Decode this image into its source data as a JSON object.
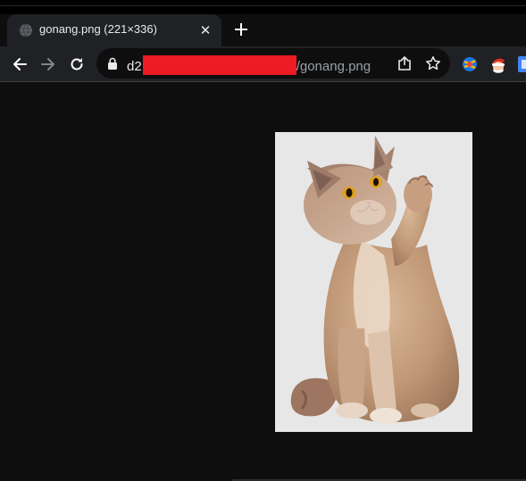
{
  "tab": {
    "title": "gonang.png (221×336)",
    "favicon": "globe-icon",
    "close": "✕"
  },
  "toolbar": {
    "back": "arrow-left-icon",
    "forward": "arrow-right-icon",
    "reload": "reload-icon"
  },
  "omnibox": {
    "host_prefix": "d2",
    "path": "/gonang.png",
    "redaction_color": "#ec1b24"
  },
  "icons": {
    "share": "share-icon",
    "bookmark": "star-icon",
    "extensions": [
      "extension-ball-icon",
      "extension-santa-icon",
      "extension-google-icon"
    ]
  },
  "colors": {
    "page_bg": "#0e0e0e",
    "chrome_bg": "#202124",
    "image_bg": "#e7e7e7"
  }
}
